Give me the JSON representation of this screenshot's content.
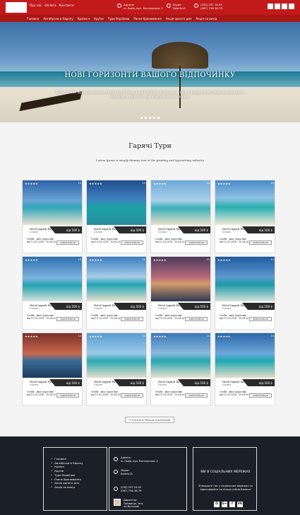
{
  "header": {
    "links": [
      "Про нас",
      "Оплата",
      "Контакти"
    ],
    "address_label": "Адреса:",
    "address": "м. Львів, вул. Котлярська, 2",
    "skype_label": "Skype:",
    "skype": "Bolaris15",
    "phones": [
      "(032) 297 16-45",
      "(067) 756-38-76"
    ],
    "social": [
      "vk-icon",
      "facebook-icon",
      "google-plus-icon",
      "odnoklassniki-icon"
    ]
  },
  "nav": [
    "Головна",
    "Автобусом в Європу",
    "Країни ▾",
    "Круїзи",
    "Тури Україною",
    "Раннє бронювання",
    "Акція одного дня",
    "Акція на вихід"
  ],
  "hero": {
    "title": "НОВІ ГОРИЗОНТИ ВАШОГО ВІДПОЧИНКУ",
    "text": "Ми постійно шукаємо нові напрямки відпочинку і пропонуємо ексклюзивні тури з найкращими умовами для наших клієнтів та турботою про кожну деталь подорожі",
    "slides": 5
  },
  "section": {
    "title": "Гарячі Тури",
    "subtitle": "Lorem Ipsum is simply dummy text of the printing and typesetting industry"
  },
  "tours": [
    {
      "hotel": "Hotel Іmpark PATAYA",
      "country": "Іспанія",
      "price": "від 500 $",
      "persons": "Особи - двоє дорослих",
      "dates": "від 15.03.2016 - 15.04.2016",
      "book": "ЗАБРОНЮВАТИ",
      "stars": "★★★★★",
      "views": "14"
    },
    {
      "hotel": "Hotel Іmpark PATAYA",
      "country": "Іспанія",
      "price": "від 500 $",
      "persons": "Особи - двоє дорослих",
      "dates": "від 15.03.2016 - 15.04.2016",
      "book": "ЗАБРОНЮВАТИ",
      "stars": "★★★★★",
      "views": "14"
    },
    {
      "hotel": "Hotel Іmpark PATAYA",
      "country": "Іспанія",
      "price": "від 500 $",
      "persons": "Особи - двоє дорослих",
      "dates": "від 15.03.2016 - 15.04.2016",
      "book": "ЗАБРОНЮВАТИ",
      "stars": "★★★★★",
      "views": "14"
    },
    {
      "hotel": "Hotel Іmpark PATAYA",
      "country": "Іспанія",
      "price": "від 500 $",
      "persons": "Особи - двоє дорослих",
      "dates": "від 15.03.2016 - 15.04.2016",
      "book": "ЗАБРОНЮВАТИ",
      "stars": "★★★★★",
      "views": "15"
    },
    {
      "hotel": "Hotel Іmpark PATAYA",
      "country": "Іспанія",
      "price": "від 500 $",
      "persons": "Особи - двоє дорослих",
      "dates": "від 15.03.2016 - 15.04.2016",
      "book": "ЗАБРОНЮВАТИ",
      "stars": "★★★★★",
      "views": "14"
    },
    {
      "hotel": "Hotel Іmpark PATAYA",
      "country": "Іспанія",
      "price": "від 500 $",
      "persons": "Особи - двоє дорослих",
      "dates": "від 15.03.2016 - 15.04.2016",
      "book": "ЗАБРОНЮВАТИ",
      "stars": "★★★★★",
      "views": "14"
    },
    {
      "hotel": "Hotel Іmpark PATAYA",
      "country": "Іспанія",
      "price": "від 500 $",
      "persons": "Особи - двоє дорослих",
      "dates": "від 15.03.2016 - 15.04.2016",
      "book": "ЗАБРОНЮВАТИ",
      "stars": "★★★★★",
      "views": "14"
    },
    {
      "hotel": "Hotel Іmpark PATAYA",
      "country": "Іспанія",
      "price": "від 500 $",
      "persons": "Особи - двоє дорослих",
      "dates": "від 15.03.2016 - 15.04.2016",
      "book": "ЗАБРОНЮВАТИ",
      "stars": "★★★★★",
      "views": "14"
    },
    {
      "hotel": "Hotel Іmpark PATAYA",
      "country": "Іспанія",
      "price": "від 500 $",
      "persons": "Особи - двоє дорослих",
      "dates": "від 15.03.2016 - 15.04.2016",
      "book": "ЗАБРОНЮВАТИ",
      "stars": "★★★★★",
      "views": "14"
    },
    {
      "hotel": "Hotel Іmpark PATAYA",
      "country": "Іспанія",
      "price": "від 500 $",
      "persons": "Особи - двоє дорослих",
      "dates": "від 15.03.2016 - 15.04.2016",
      "book": "ЗАБРОНЮВАТИ",
      "stars": "★★★★★",
      "views": "14"
    },
    {
      "hotel": "Hotel Іmpark PATAYA",
      "country": "Іспанія",
      "price": "від 500 $",
      "persons": "Особи - двоє дорослих",
      "dates": "від 15.03.2016 - 15.04.2016",
      "book": "ЗАБРОНЮВАТИ",
      "stars": "★★★★★",
      "views": "14"
    },
    {
      "hotel": "Hotel Іmpark PATAYA",
      "country": "Іспанія",
      "price": "від 500 $",
      "persons": "Особи - двоє дорослих",
      "dates": "від 15.03.2016 - 15.04.2016",
      "book": "ЗАБРОНЮВАТИ",
      "stars": "★★★★★",
      "views": "14"
    }
  ],
  "more_button": "⟳ Показати більше пропозицій",
  "footer": {
    "menu": [
      "Головна",
      "Автобусом в Європу",
      "Країни",
      "Круїзи",
      "Тури Україною",
      "Раннє бронювання",
      "Акція одного дня",
      "Акція на вихід"
    ],
    "address_label": "Адреса:",
    "address": "м. Львів, вул. Котлярська, 2",
    "skype_label": "Skype:",
    "skype": "Bolaris15",
    "phones": [
      "(032) 297 16-45",
      "(067) 756-38-76"
    ],
    "director_label": "Директор:",
    "director": "Прізвище, Ім'я,",
    "director_2": "по-батькові",
    "social_title": "МИ В СОЦІАЛЬНИХ МЕРЕЖАХ",
    "social_text": "Знаходьте нас у соціальних мережах та відпочивайте на кілька кліків ближче",
    "social_icons": [
      "О",
      "G+",
      "f",
      "VK"
    ]
  }
}
